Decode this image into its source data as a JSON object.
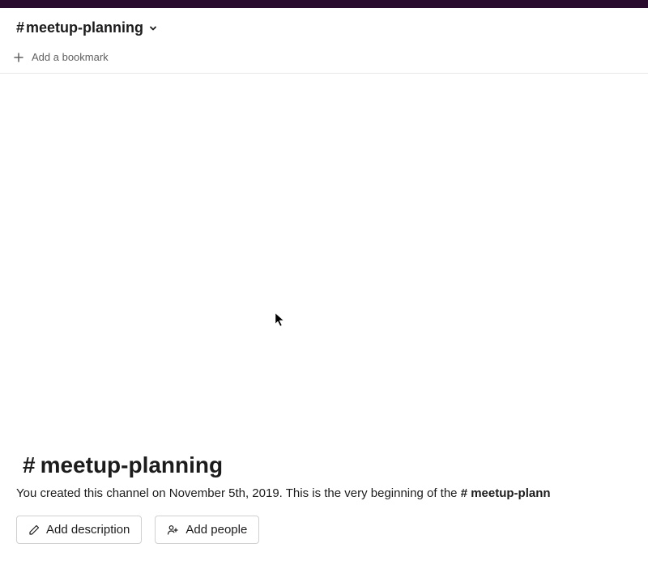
{
  "header": {
    "channel_name": "meetup-planning"
  },
  "bookmark": {
    "add_label": "Add a bookmark"
  },
  "intro": {
    "channel_name": "meetup-planning",
    "description_prefix": "You created this channel on November 5th, 2019. This is the very beginning of the ",
    "description_channel": "# meetup-plann"
  },
  "actions": {
    "add_description_label": "Add description",
    "add_people_label": "Add people"
  }
}
